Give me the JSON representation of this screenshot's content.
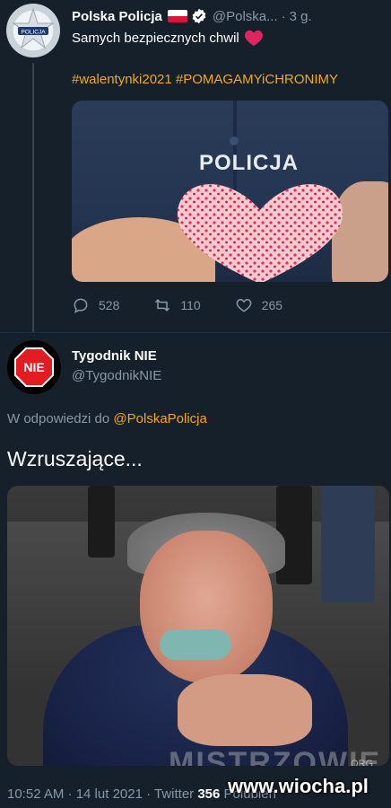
{
  "parent_tweet": {
    "author_name": "Polska Policja",
    "handle": "@Polska...",
    "separator": "·",
    "time": "3 g.",
    "text": "Samych bezpiecznych chwil",
    "hashtags": [
      "#walentynki2021",
      "#POMAGAMYiCHRONIMY"
    ],
    "avatar_text": "POLICJA",
    "image_label": "POLICJA",
    "actions": {
      "replies": "528",
      "retweets": "110",
      "likes": "265"
    }
  },
  "main_tweet": {
    "author_name": "Tygodnik NIE",
    "handle": "@TygodnikNIE",
    "avatar_text": "NIE",
    "reply_prefix": "W odpowiedzi do",
    "reply_mention": "@PolskaPolicja",
    "text": "Wzruszające...",
    "image_watermark": "MISTRZOWIE",
    "image_watermark_suffix": ".ORG",
    "meta_time": "10:52 AM · 14 lut 2021 · Twitter",
    "meta_count": "356",
    "meta_label": "Polubień"
  },
  "site_watermark": "www.wiocha.pl",
  "colors": {
    "background": "#15202b",
    "secondary_text": "#8899a6",
    "accent": "#f5a623",
    "heart": "#e0245e",
    "thread_line": "#38444d"
  }
}
